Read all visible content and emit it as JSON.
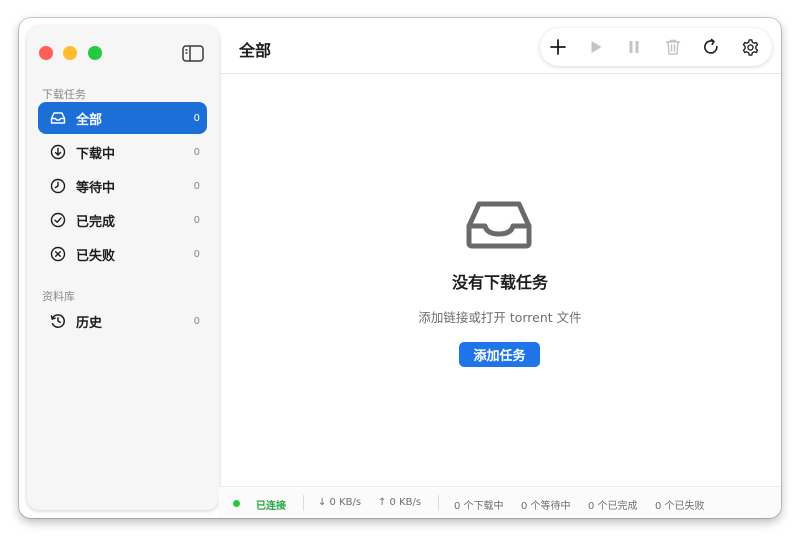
{
  "sidebar": {
    "sections": [
      {
        "label": "下载任务"
      },
      {
        "label": "资料库"
      }
    ],
    "items": [
      {
        "label": "全部",
        "count": "0",
        "icon": "inbox-icon",
        "active": true
      },
      {
        "label": "下载中",
        "count": "0",
        "icon": "arrow-down-circle-icon"
      },
      {
        "label": "等待中",
        "count": "0",
        "icon": "clock-icon"
      },
      {
        "label": "已完成",
        "count": "0",
        "icon": "check-circle-icon"
      },
      {
        "label": "已失败",
        "count": "0",
        "icon": "x-circle-icon"
      },
      {
        "label": "历史",
        "count": "0",
        "icon": "history-icon"
      }
    ]
  },
  "header": {
    "title": "全部",
    "toolbar": [
      "plus-icon",
      "play-icon",
      "pause-icon",
      "trash-icon",
      "refresh-icon",
      "gear-icon"
    ]
  },
  "empty_state": {
    "title": "没有下载任务",
    "subtitle": "添加链接或打开 torrent 文件",
    "button_label": "添加任务"
  },
  "status_bar": {
    "connection": "已连接",
    "download_speed": "↓ 0 KB/s",
    "upload_speed": "↑ 0 KB/s",
    "downloading": "0 个下载中",
    "waiting": "0 个等待中",
    "completed": "0 个已完成",
    "failed": "0 个已失败"
  },
  "colors": {
    "accent": "#1f75e8",
    "sidebar_active": "#1d6fd8",
    "connected": "#28c840",
    "icon_disabled": "#c4c4c4"
  }
}
